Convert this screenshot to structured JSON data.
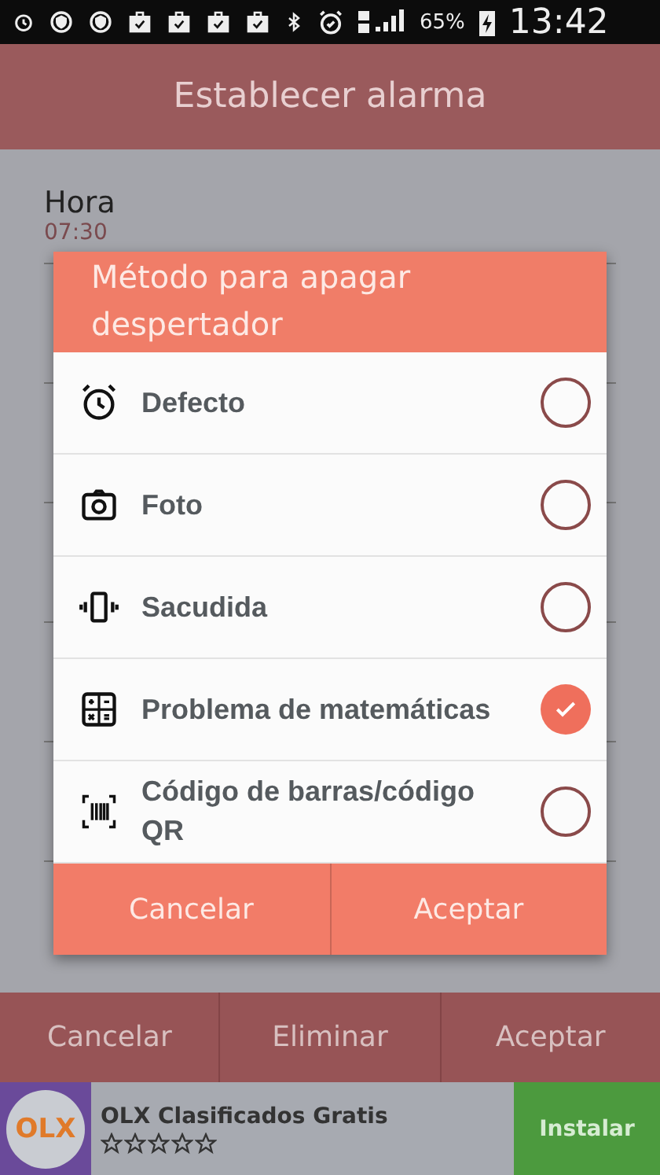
{
  "status_bar": {
    "battery": "65%",
    "time": "13:42"
  },
  "title": "Establecer alarma",
  "settings": [
    {
      "label": "Hora",
      "value": "07:30"
    }
  ],
  "dialog": {
    "title": "Método para apagar despertador",
    "options": [
      {
        "kind": "alarm",
        "label": "Defecto",
        "selected": false
      },
      {
        "kind": "camera",
        "label": "Foto",
        "selected": false
      },
      {
        "kind": "vibrate",
        "label": "Sacudida",
        "selected": false
      },
      {
        "kind": "math",
        "label": "Problema de matemáticas",
        "selected": true
      },
      {
        "kind": "barcode",
        "label": "Código de barras/código QR",
        "selected": false
      }
    ],
    "buttons": [
      "Cancelar",
      "Aceptar"
    ]
  },
  "bottom_buttons": [
    "Cancelar",
    "Eliminar",
    "Aceptar"
  ],
  "ad": {
    "logo": "OLX",
    "title": "OLX Clasificados Gratis",
    "stars": 0,
    "button": "Instalar"
  }
}
